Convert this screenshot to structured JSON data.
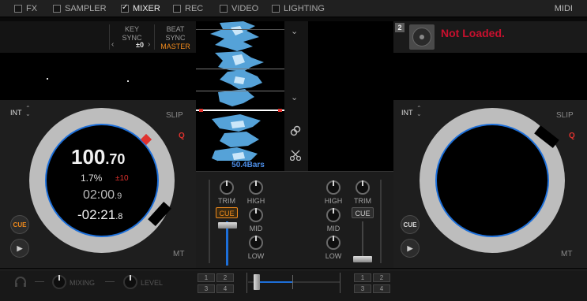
{
  "tabs": [
    {
      "label": "FX",
      "checked": false
    },
    {
      "label": "SAMPLER",
      "checked": false
    },
    {
      "label": "MIXER",
      "checked": true
    },
    {
      "label": "REC",
      "checked": false
    },
    {
      "label": "VIDEO",
      "checked": false
    },
    {
      "label": "LIGHTING",
      "checked": false
    }
  ],
  "midi_label": "MIDI",
  "deck1": {
    "key_sync_label": "KEY\nSYNC",
    "key_value": "±0",
    "beat_sync_label": "BEAT\nSYNC",
    "master_label": "MASTER",
    "mode_label": "INT",
    "slip_label": "SLIP",
    "q_label": "Q",
    "mt_label": "MT",
    "cue_label": "CUE",
    "bpm_int": "100",
    "bpm_dec": ".70",
    "pitch": "1.7%",
    "pitch_range": "±10",
    "elapsed_main": "02:00",
    "elapsed_frac": ".9",
    "remain_main": "-02:21",
    "remain_frac": ".8"
  },
  "deck2": {
    "number": "2",
    "status": "Not Loaded.",
    "mode_label": "INT",
    "slip_label": "SLIP",
    "q_label": "Q",
    "mt_label": "MT",
    "cue_label": "CUE"
  },
  "waveform": {
    "bars_label": "50.4Bars"
  },
  "mixer": {
    "left": {
      "trim": "TRIM",
      "high": "HIGH",
      "mid": "MID",
      "low": "LOW",
      "cue": "CUE"
    },
    "right": {
      "trim": "TRIM",
      "high": "HIGH",
      "mid": "MID",
      "low": "LOW",
      "cue": "CUE"
    }
  },
  "bottom": {
    "mixing_label": "MIXING",
    "level_label": "LEVEL",
    "left_assign": [
      "1",
      "2",
      "3",
      "4"
    ],
    "right_assign": [
      "1",
      "2",
      "3",
      "4"
    ]
  },
  "colors": {
    "accent_blue": "#1d6fd9",
    "master_orange": "#f08a1c",
    "not_loaded_red": "#c8102e",
    "q_red": "#e0322e"
  }
}
